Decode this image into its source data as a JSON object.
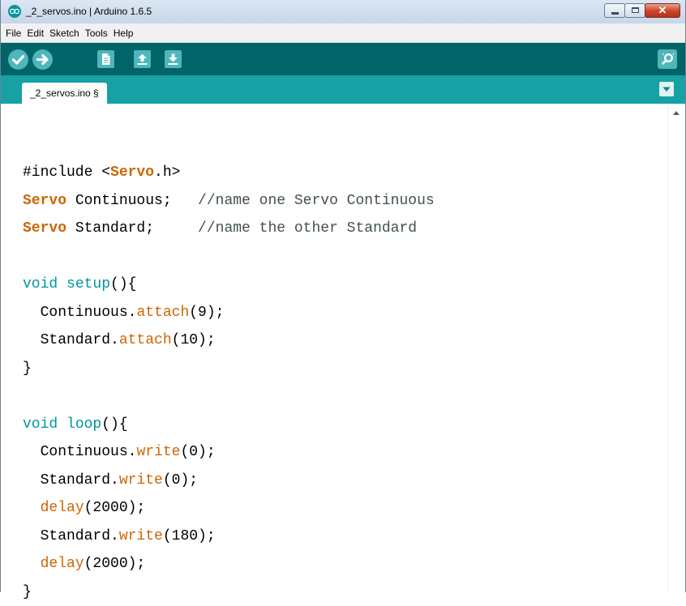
{
  "window": {
    "title": "_2_servos.ino | Arduino 1.6.5",
    "close_label": "✕"
  },
  "menubar": {
    "items": [
      "File",
      "Edit",
      "Sketch",
      "Tools",
      "Help"
    ]
  },
  "toolbar": {
    "buttons": [
      {
        "name": "verify",
        "icon": "checkmark-icon"
      },
      {
        "name": "upload",
        "icon": "arrow-right-icon"
      },
      {
        "name": "new",
        "icon": "new-document-icon"
      },
      {
        "name": "open",
        "icon": "arrow-up-icon"
      },
      {
        "name": "save",
        "icon": "arrow-down-icon"
      }
    ],
    "serial_monitor_icon": "magnifier-icon"
  },
  "tabs": [
    {
      "label": "_2_servos.ino §",
      "active": true
    }
  ],
  "editor": {
    "lines": [
      [
        {
          "t": "#include <",
          "c": "plain"
        },
        {
          "t": "Servo",
          "c": "kwb"
        },
        {
          "t": ".h>",
          "c": "plain"
        }
      ],
      [
        {
          "t": "Servo",
          "c": "kwb"
        },
        {
          "t": " Continuous;   ",
          "c": "plain"
        },
        {
          "t": "//name one Servo Continuous",
          "c": "comment"
        }
      ],
      [
        {
          "t": "Servo",
          "c": "kwb"
        },
        {
          "t": " Standard;     ",
          "c": "plain"
        },
        {
          "t": "//name the other Standard",
          "c": "comment"
        }
      ],
      [
        {
          "t": "",
          "c": "plain"
        }
      ],
      [
        {
          "t": "void",
          "c": "type"
        },
        {
          "t": " ",
          "c": "plain"
        },
        {
          "t": "setup",
          "c": "type"
        },
        {
          "t": "(){",
          "c": "plain"
        }
      ],
      [
        {
          "t": "  Continuous.",
          "c": "plain"
        },
        {
          "t": "attach",
          "c": "kw"
        },
        {
          "t": "(9);",
          "c": "plain"
        }
      ],
      [
        {
          "t": "  Standard.",
          "c": "plain"
        },
        {
          "t": "attach",
          "c": "kw"
        },
        {
          "t": "(10);",
          "c": "plain"
        }
      ],
      [
        {
          "t": "}",
          "c": "plain"
        }
      ],
      [
        {
          "t": "",
          "c": "plain"
        }
      ],
      [
        {
          "t": "void",
          "c": "type"
        },
        {
          "t": " ",
          "c": "plain"
        },
        {
          "t": "loop",
          "c": "type"
        },
        {
          "t": "(){",
          "c": "plain"
        }
      ],
      [
        {
          "t": "  Continuous.",
          "c": "plain"
        },
        {
          "t": "write",
          "c": "kw"
        },
        {
          "t": "(0);",
          "c": "plain"
        }
      ],
      [
        {
          "t": "  Standard.",
          "c": "plain"
        },
        {
          "t": "write",
          "c": "kw"
        },
        {
          "t": "(0);",
          "c": "plain"
        }
      ],
      [
        {
          "t": "  ",
          "c": "plain"
        },
        {
          "t": "delay",
          "c": "kw"
        },
        {
          "t": "(2000);",
          "c": "plain"
        }
      ],
      [
        {
          "t": "  Standard.",
          "c": "plain"
        },
        {
          "t": "write",
          "c": "kw"
        },
        {
          "t": "(180);",
          "c": "plain"
        }
      ],
      [
        {
          "t": "  ",
          "c": "plain"
        },
        {
          "t": "delay",
          "c": "kw"
        },
        {
          "t": "(2000);",
          "c": "plain"
        }
      ],
      [
        {
          "t": "}",
          "c": "plain"
        }
      ]
    ]
  },
  "colors": {
    "toolbar": "#006468",
    "tabbar": "#17a1a5",
    "button": "#4db7bb",
    "keyword": "#cc6600",
    "type": "#00979c",
    "comment": "#434f54"
  }
}
